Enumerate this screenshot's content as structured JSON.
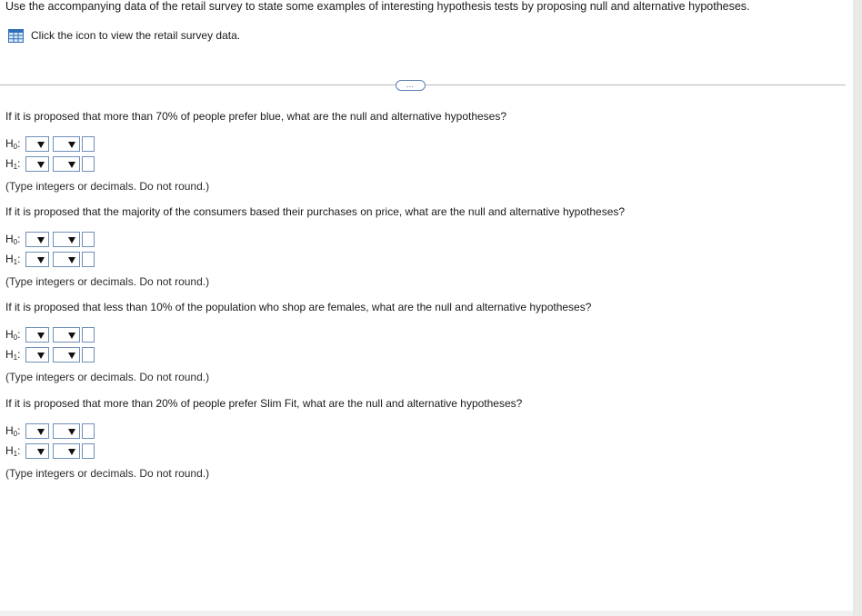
{
  "prompt": "Use the accompanying data of the retail survey to state some examples of interesting hypothesis tests by proposing null and alternative hypotheses.",
  "data_link": {
    "icon": "spreadsheet-grid-icon",
    "text": "Click the icon to view the retail survey data."
  },
  "expander_label": "…",
  "h0_label": "H",
  "h0_sub": "0",
  "h1_label": "H",
  "h1_sub": "1",
  "colon": ":",
  "questions": [
    {
      "text": "If it is proposed that more than 70% of people prefer blue, what are the null and alternative hypotheses?",
      "note": "(Type integers or decimals. Do not round.)"
    },
    {
      "text": "If it is proposed that the majority of the consumers based their purchases on price, what are the null and alternative hypotheses?",
      "note": "(Type integers or decimals. Do not round.)"
    },
    {
      "text": "If it is proposed that less than 10% of the population who shop are females, what are the null and alternative hypotheses?",
      "note": "(Type integers or decimals. Do not round.)"
    },
    {
      "text": "If it is proposed that more than 20% of people prefer Slim Fit, what are the null and alternative hypotheses?",
      "note": "(Type integers or decimals. Do not round.)"
    }
  ],
  "colors": {
    "control_border": "#6f8fb8",
    "icon_blue": "#2f6fb5",
    "divider": "#b9b9b9"
  }
}
